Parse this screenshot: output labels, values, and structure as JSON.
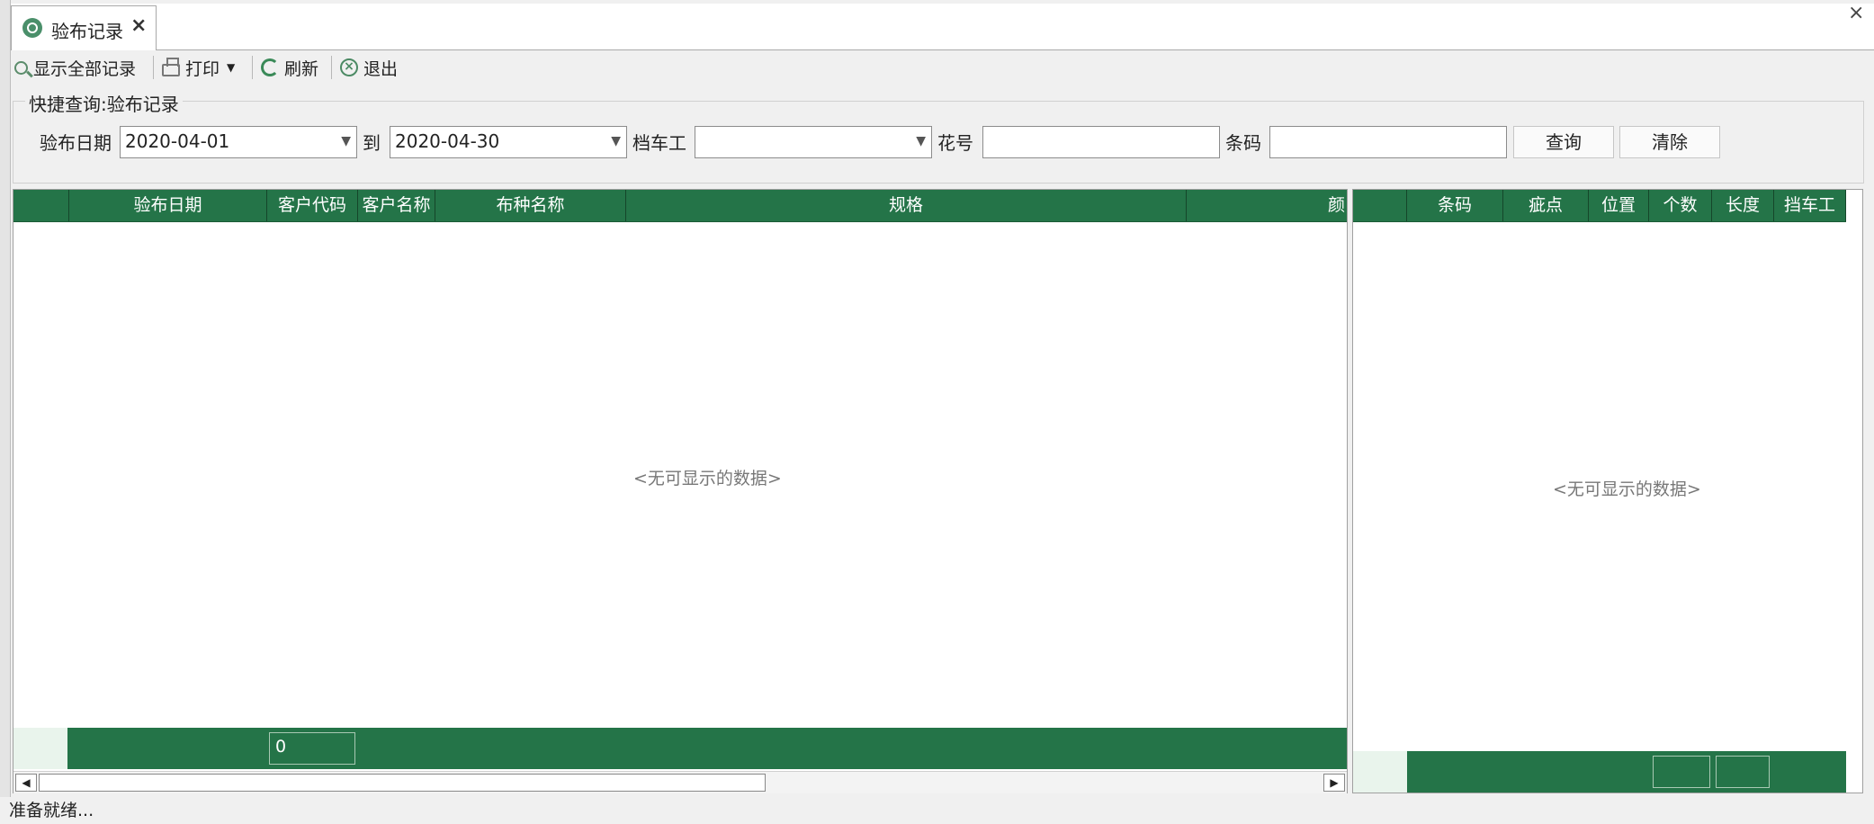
{
  "tab": {
    "title": "验布记录",
    "close": "×"
  },
  "window": {
    "close": "×"
  },
  "toolbar": {
    "show_all": "显示全部记录",
    "print": "打印",
    "refresh": "刷新",
    "exit": "退出"
  },
  "query": {
    "legend": "快捷查询:验布记录",
    "date_label": "验布日期",
    "date_from": "2020-04-01",
    "to_label": "到",
    "date_to": "2020-04-30",
    "operator_label": "档车工",
    "operator_value": "",
    "pattern_label": "花号",
    "pattern_value": "",
    "barcode_label": "条码",
    "barcode_value": "",
    "search_button": "查询",
    "clear_button": "清除"
  },
  "main_grid": {
    "columns": [
      "",
      "验布日期",
      "客户代码",
      "客户名称",
      "布种名称",
      "规格",
      "颜"
    ],
    "rows": [],
    "empty_text": "<无可显示的数据>",
    "footer_count": "0"
  },
  "detail_grid": {
    "columns": [
      "",
      "条码",
      "疵点",
      "位置",
      "个数",
      "长度",
      "挡车工"
    ],
    "rows": [],
    "empty_text": "<无可显示的数据>"
  },
  "status": {
    "text": "准备就绪..."
  },
  "colors": {
    "grid_header": "#247448",
    "accent": "#3a8a58"
  }
}
